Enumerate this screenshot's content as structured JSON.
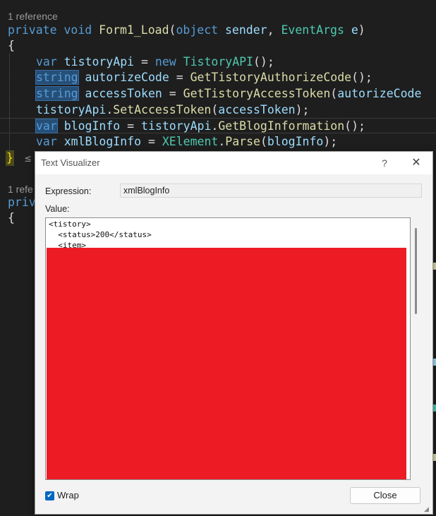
{
  "editor": {
    "codelens_1": "1 reference",
    "codelens_2": "1 refe",
    "line_1": {
      "kw1": "private",
      "kw2": "void",
      "fn": "Form1_Load",
      "p1": "(",
      "kw3": "object",
      "id1": "sender",
      "p2": ",",
      "ty": "EventArgs",
      "id2": "e",
      "p3": ")"
    },
    "open_brace": "{",
    "line_3": {
      "kw": "var",
      "id": "tistoryApi",
      "op": "=",
      "kw2": "new",
      "ty": "TistoryAPI",
      "tail": "();"
    },
    "line_4": {
      "kw": "string",
      "id": "autorizeCode",
      "op": "=",
      "fn": "GetTistoryAuthorizeCode",
      "tail": "();"
    },
    "line_5": {
      "kw": "string",
      "id": "accessToken",
      "op": "=",
      "fn": "GetTistoryAccessToken",
      "p": "(",
      "arg": "autorizeCode"
    },
    "line_6": {
      "obj": "tistoryApi",
      "dot": ".",
      "fn": "SetAccessToken",
      "p": "(",
      "arg": "accessToken",
      "tail": ");"
    },
    "line_7": {
      "kw": "var",
      "id": "blogInfo",
      "op": "=",
      "obj": "tistoryApi",
      "dot": ".",
      "fn": "GetBlogInformation",
      "tail": "();"
    },
    "line_8": {
      "kw": "var",
      "id": "xmlBlogInfo",
      "op": "=",
      "ty": "XElement",
      "dot": ".",
      "fn": "Parse",
      "p": "(",
      "arg": "blogInfo",
      "tail": ");"
    },
    "close_brace": "}",
    "le": "≤",
    "line_b1": {
      "kw": "priv"
    },
    "open_brace_2": "{"
  },
  "dialog": {
    "title": "Text Visualizer",
    "help": "?",
    "close_glyph": "✕",
    "expression_label": "Expression:",
    "expression_value": "xmlBlogInfo",
    "value_label": "Value:",
    "value_lines": [
      "<tistory>",
      "  <status>200</status>",
      "  <item>"
    ],
    "wrap_label": "Wrap",
    "wrap_checked": true,
    "check_glyph": "✔",
    "close_button": "Close",
    "redaction_color": "#ed1c24"
  },
  "colors": {
    "editor_bg": "#1e1e1e",
    "keyword": "#569cd6",
    "type": "#4ec9b0",
    "method": "#dcdcaa",
    "identifier": "#9cdcfe",
    "highlight": "#264f78",
    "accent": "#0067c0"
  }
}
